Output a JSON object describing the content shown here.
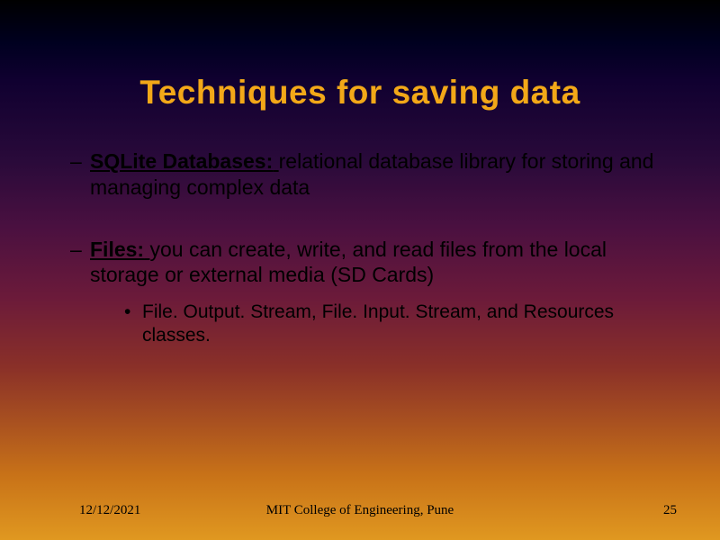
{
  "slide": {
    "title": "Techniques for saving data",
    "bullets": [
      {
        "heading": "SQLite Databases:",
        "body": "relational database library for storing and managing complex data"
      },
      {
        "heading": "Files:",
        "body": "you can create, write, and read files from the local storage or external media (SD Cards)",
        "sub": "File. Output. Stream, File. Input. Stream, and Resources classes."
      }
    ]
  },
  "footer": {
    "date": "12/12/2021",
    "center": "MIT College of Engineering, Pune",
    "page": "25"
  }
}
